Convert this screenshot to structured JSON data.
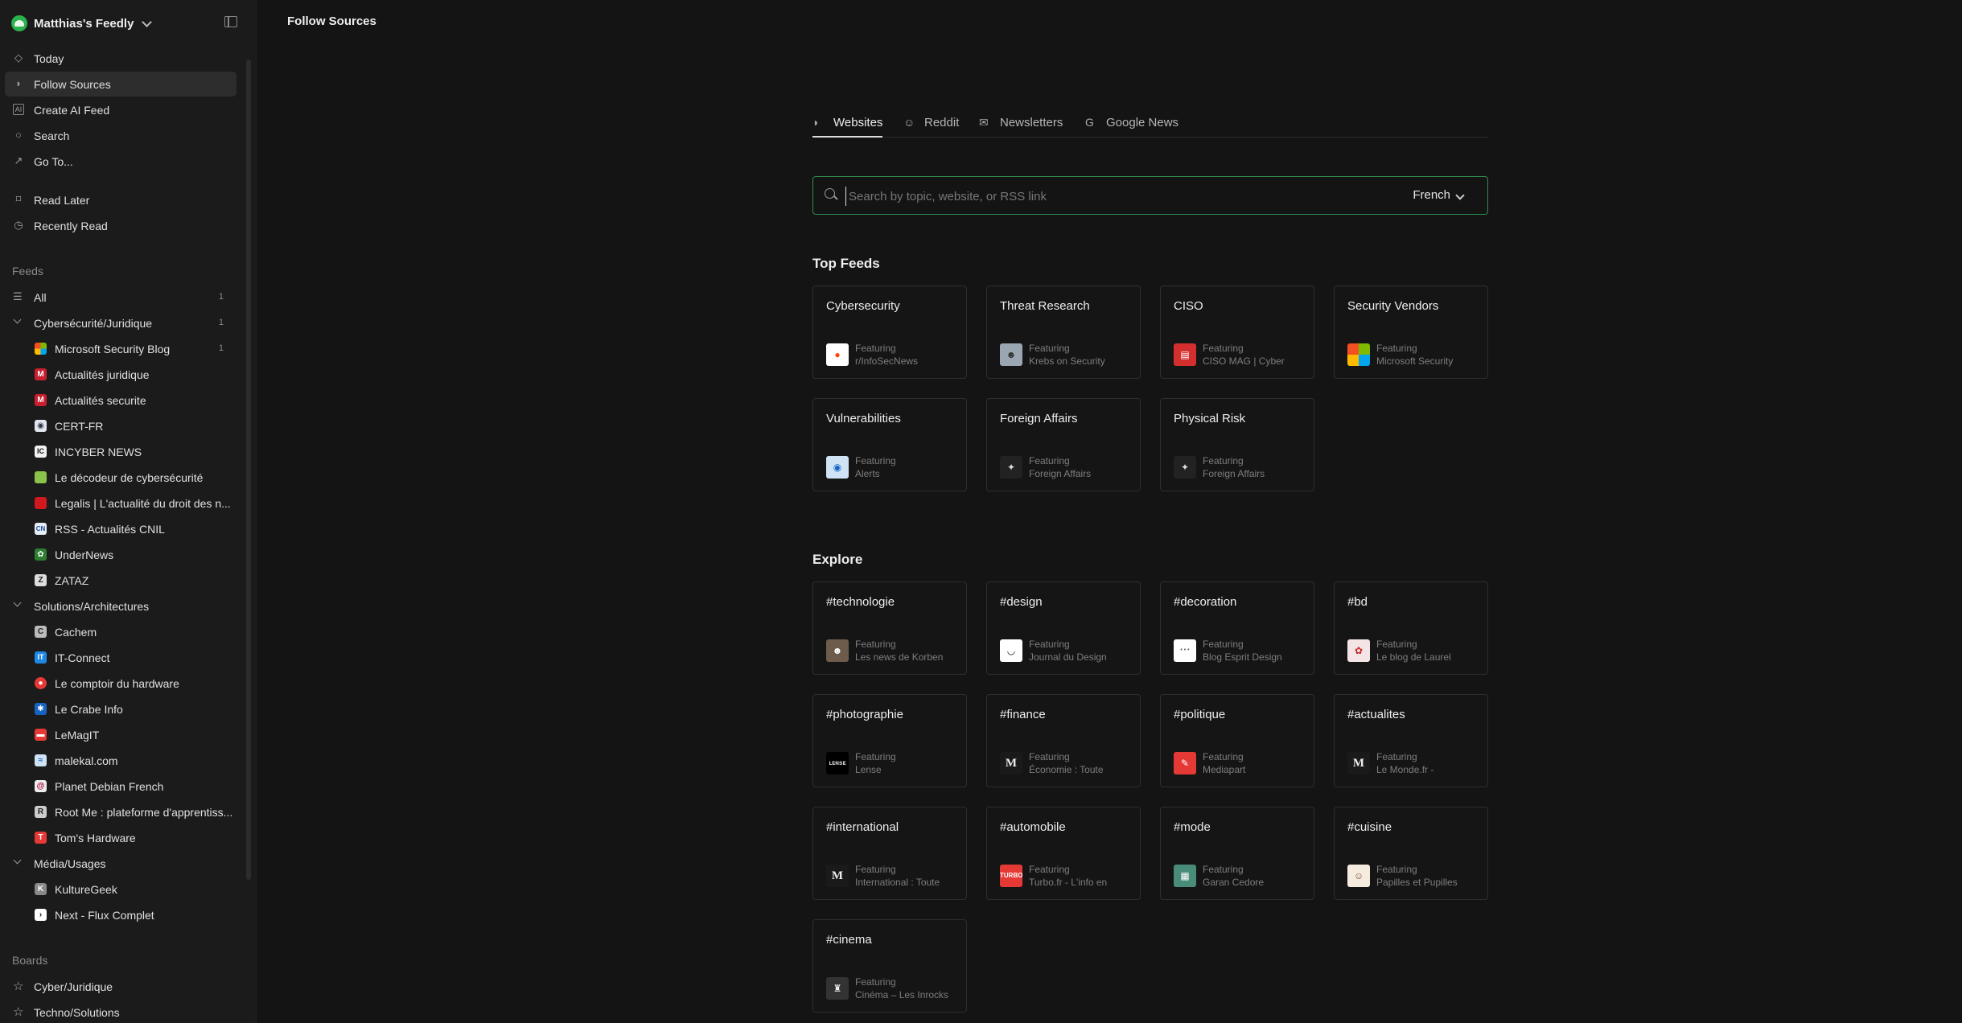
{
  "workspace": {
    "title": "Matthias's Feedly"
  },
  "nav": {
    "today": "Today",
    "follow": "Follow Sources",
    "create_ai": "Create AI Feed",
    "search": "Search",
    "goto": "Go To...",
    "read_later": "Read Later",
    "recently_read": "Recently Read"
  },
  "feeds": {
    "label": "Feeds",
    "all": {
      "label": "All",
      "count": "1"
    },
    "cat1": {
      "label": "Cybersécurité/Juridique",
      "count": "1",
      "items": [
        {
          "label": "Microsoft Security Blog",
          "count": "1"
        },
        {
          "label": "Actualités juridique"
        },
        {
          "label": "Actualités securite"
        },
        {
          "label": "CERT-FR"
        },
        {
          "label": "INCYBER NEWS"
        },
        {
          "label": "Le décodeur de cybersécurité"
        },
        {
          "label": "Legalis | L'actualité du droit des n..."
        },
        {
          "label": "RSS - Actualités CNIL"
        },
        {
          "label": "UnderNews"
        },
        {
          "label": "ZATAZ"
        }
      ]
    },
    "cat2": {
      "label": "Solutions/Architectures",
      "items": [
        {
          "label": "Cachem"
        },
        {
          "label": "IT-Connect"
        },
        {
          "label": "Le comptoir du hardware"
        },
        {
          "label": "Le Crabe Info"
        },
        {
          "label": "LeMagIT"
        },
        {
          "label": "malekal.com"
        },
        {
          "label": "Planet Debian French"
        },
        {
          "label": "Root Me : plateforme d'apprentiss..."
        },
        {
          "label": "Tom's Hardware"
        }
      ]
    },
    "cat3": {
      "label": "Média/Usages",
      "items": [
        {
          "label": "KultureGeek"
        },
        {
          "label": "Next - Flux Complet"
        }
      ]
    }
  },
  "boards": {
    "label": "Boards",
    "items": [
      {
        "label": "Cyber/Juridique"
      },
      {
        "label": "Techno/Solutions"
      }
    ]
  },
  "main": {
    "title": "Follow Sources",
    "tabs": [
      {
        "label": "Websites"
      },
      {
        "label": "Reddit"
      },
      {
        "label": "Newsletters"
      },
      {
        "label": "Google News"
      }
    ],
    "search_placeholder": "Search by topic, website, or RSS link",
    "language": "French",
    "top_feeds_title": "Top Feeds",
    "top_feeds": [
      {
        "title": "Cybersecurity",
        "featuring": "Featuring",
        "source": "r/InfoSecNews"
      },
      {
        "title": "Threat Research",
        "featuring": "Featuring",
        "source": "Krebs on Security"
      },
      {
        "title": "CISO",
        "featuring": "Featuring",
        "source": "CISO MAG | Cyber"
      },
      {
        "title": "Security Vendors",
        "featuring": "Featuring",
        "source": "Microsoft Security"
      },
      {
        "title": "Vulnerabilities",
        "featuring": "Featuring",
        "source": "Alerts"
      },
      {
        "title": "Foreign Affairs",
        "featuring": "Featuring",
        "source": "Foreign Affairs"
      },
      {
        "title": "Physical Risk",
        "featuring": "Featuring",
        "source": "Foreign Affairs"
      }
    ],
    "explore_title": "Explore",
    "explore": [
      {
        "title": "#technologie",
        "featuring": "Featuring",
        "source": "Les news de Korben"
      },
      {
        "title": "#design",
        "featuring": "Featuring",
        "source": "Journal du Design"
      },
      {
        "title": "#decoration",
        "featuring": "Featuring",
        "source": "Blog Esprit Design"
      },
      {
        "title": "#bd",
        "featuring": "Featuring",
        "source": "Le blog de Laurel"
      },
      {
        "title": "#photographie",
        "featuring": "Featuring",
        "source": "Lense"
      },
      {
        "title": "#finance",
        "featuring": "Featuring",
        "source": "Économie : Toute"
      },
      {
        "title": "#politique",
        "featuring": "Featuring",
        "source": "Mediapart"
      },
      {
        "title": "#actualites",
        "featuring": "Featuring",
        "source": "Le Monde.fr -"
      },
      {
        "title": "#international",
        "featuring": "Featuring",
        "source": "International : Toute"
      },
      {
        "title": "#automobile",
        "featuring": "Featuring",
        "source": "Turbo.fr - L'info en"
      },
      {
        "title": "#mode",
        "featuring": "Featuring",
        "source": "Garan Cedore"
      },
      {
        "title": "#cuisine",
        "featuring": "Featuring",
        "source": "Papilles et Pupilles"
      },
      {
        "title": "#cinema",
        "featuring": "Featuring",
        "source": "Cinéma – Les Inrocks"
      }
    ]
  }
}
